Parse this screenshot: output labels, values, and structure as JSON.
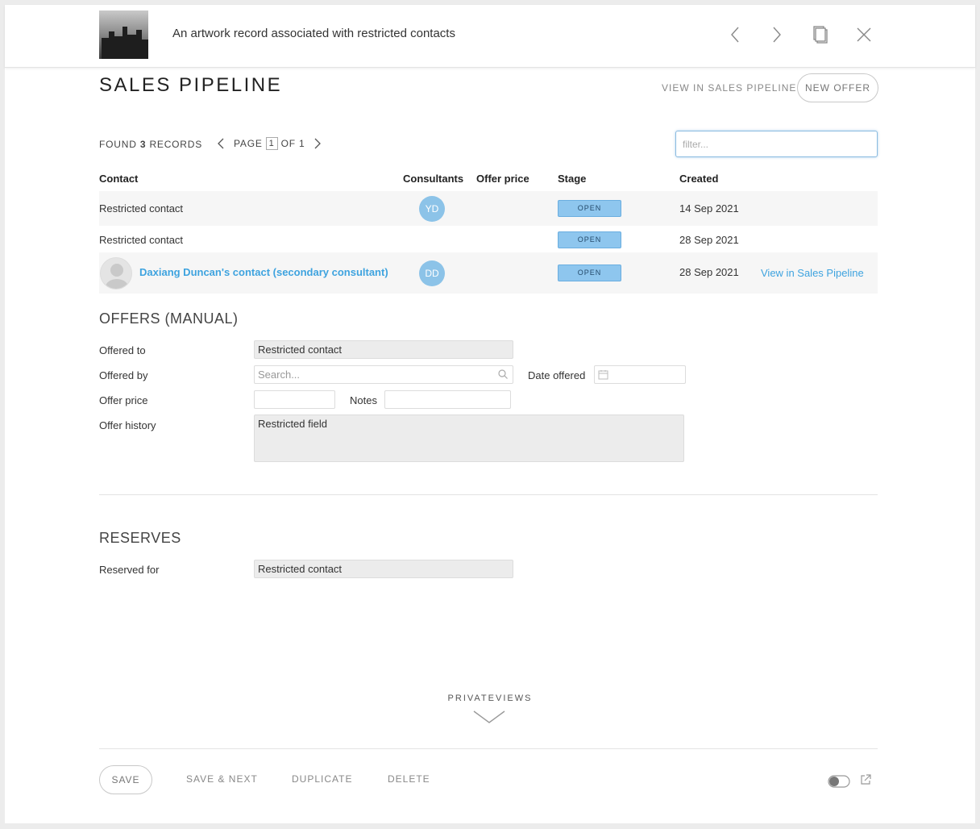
{
  "header": {
    "title": "An artwork record associated with restricted contacts",
    "icons": [
      "chevron-left-icon",
      "chevron-right-icon",
      "copy-icon",
      "close-icon"
    ]
  },
  "pipeline": {
    "title": "SALES PIPELINE",
    "view_link": "VIEW IN SALES PIPELINE",
    "new_offer": "NEW OFFER",
    "found_prefix": "FOUND",
    "found_count": "3",
    "found_suffix": "RECORDS",
    "page_label": "PAGE",
    "page_num": "1",
    "page_of": "OF 1",
    "filter_placeholder": "filter...",
    "columns": {
      "contact": "Contact",
      "consultants": "Consultants",
      "offer_price": "Offer price",
      "stage": "Stage",
      "created": "Created"
    },
    "rows": [
      {
        "contact": "Restricted contact",
        "consultant": "YD",
        "stage": "OPEN",
        "created": "14 Sep 2021"
      },
      {
        "contact": "Restricted contact",
        "consultant": "",
        "stage": "OPEN",
        "created": "28 Sep 2021"
      },
      {
        "contact": "Daxiang Duncan's contact (secondary consultant)",
        "consultant": "DD",
        "stage": "OPEN",
        "created": "28 Sep 2021",
        "link": "View in Sales Pipeline"
      }
    ]
  },
  "offers": {
    "title": "OFFERS (MANUAL)",
    "offered_to_label": "Offered to",
    "offered_to_value": "Restricted contact",
    "offered_by_label": "Offered by",
    "offered_by_placeholder": "Search...",
    "date_offered_label": "Date offered",
    "offer_price_label": "Offer price",
    "notes_label": "Notes",
    "offer_history_label": "Offer history",
    "offer_history_value": "Restricted field"
  },
  "reserves": {
    "title": "RESERVES",
    "reserved_for_label": "Reserved for",
    "reserved_for_value": "Restricted contact"
  },
  "privateviews": {
    "label": "PRIVATEVIEWS"
  },
  "footer": {
    "save": "SAVE",
    "save_next": "SAVE & NEXT",
    "duplicate": "DUPLICATE",
    "delete": "DELETE"
  },
  "colors": {
    "accent": "#3ea3df",
    "stage_badge": "#8ec6ee",
    "avatar": "#8cc3e8"
  }
}
